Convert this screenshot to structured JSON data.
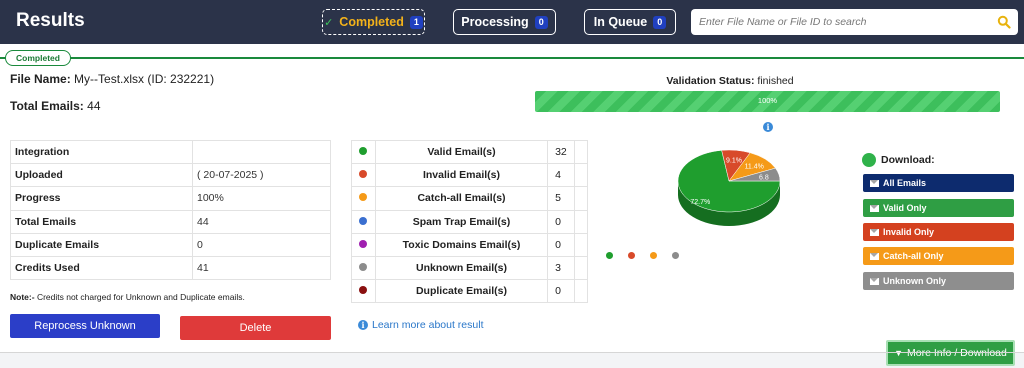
{
  "header": {
    "title": "Results",
    "tabs": [
      {
        "label": "Completed",
        "count": "1"
      },
      {
        "label": "Processing",
        "count": "0"
      },
      {
        "label": "In Queue",
        "count": "0"
      }
    ],
    "search": {
      "placeholder": "Enter File Name or File ID to search"
    }
  },
  "status_pill": "Completed",
  "file": {
    "name_label": "File Name:",
    "name_value": "My--Test.xlsx (ID: 232221)",
    "total_label": "Total Emails:",
    "total_value": "44"
  },
  "info_table": [
    {
      "key": "Integration",
      "value": ""
    },
    {
      "key": "Uploaded",
      "value": "( 20-07-2025 )"
    },
    {
      "key": "Progress",
      "value": "100%"
    },
    {
      "key": "Total Emails",
      "value": "44"
    },
    {
      "key": "Duplicate Emails",
      "value": "0"
    },
    {
      "key": "Credits Used",
      "value": "41"
    }
  ],
  "note": {
    "label": "Note:-",
    "text": "Credits not charged for Unknown and Duplicate emails."
  },
  "buttons": {
    "reprocess": "Reprocess Unknown",
    "delete": "Delete"
  },
  "results": [
    {
      "label": "Valid Email(s)",
      "count": "32",
      "color": "#1f9e2e"
    },
    {
      "label": "Invalid Email(s)",
      "count": "4",
      "color": "#d84a2a"
    },
    {
      "label": "Catch-all Email(s)",
      "count": "5",
      "color": "#f59a18"
    },
    {
      "label": "Spam Trap Email(s)",
      "count": "0",
      "color": "#3a6fd0"
    },
    {
      "label": "Toxic Domains Email(s)",
      "count": "0",
      "color": "#a020b0"
    },
    {
      "label": "Unknown Email(s)",
      "count": "3",
      "color": "#8c8c8c"
    },
    {
      "label": "Duplicate Email(s)",
      "count": "0",
      "color": "#8a1010"
    }
  ],
  "learn_more": "Learn more about result",
  "validation": {
    "label": "Validation Status:",
    "value": "finished",
    "progress_text": "100%",
    "progress": 1.0
  },
  "chart_data": {
    "type": "pie",
    "labels": [
      "Valid",
      "Invalid",
      "Catch-all",
      "Unknown"
    ],
    "values": [
      72.7,
      9.1,
      11.4,
      6.8
    ],
    "value_labels": [
      "72.7%",
      "9.1%",
      "11.4%",
      "6.8"
    ],
    "colors": [
      "#1f9e2e",
      "#d84a2a",
      "#f59a18",
      "#8c8c8c"
    ]
  },
  "download": {
    "title": "Download:",
    "buttons": [
      {
        "label": "All Emails",
        "color": "#0d2b6e"
      },
      {
        "label": "Valid Only",
        "color": "#2f9e44"
      },
      {
        "label": "Invalid Only",
        "color": "#d4411f"
      },
      {
        "label": "Catch-all Only",
        "color": "#f59a18"
      },
      {
        "label": "Unknown Only",
        "color": "#8e8e8e"
      }
    ]
  },
  "more_info": "More Info / Download"
}
